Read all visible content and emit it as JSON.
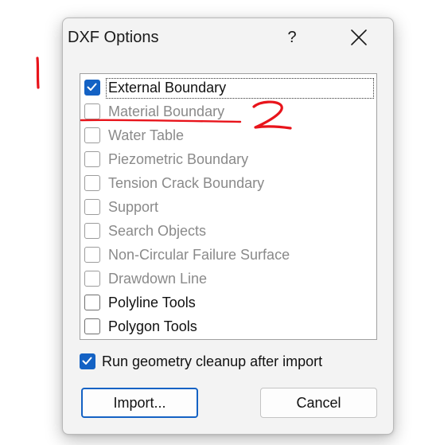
{
  "dialog": {
    "title": "DXF Options",
    "help_label": "?",
    "close_icon": "close-icon"
  },
  "list": {
    "items": [
      {
        "label": "External Boundary",
        "checked": true,
        "enabled": true
      },
      {
        "label": "Material Boundary",
        "checked": false,
        "enabled": false
      },
      {
        "label": "Water Table",
        "checked": false,
        "enabled": false
      },
      {
        "label": "Piezometric Boundary",
        "checked": false,
        "enabled": false
      },
      {
        "label": "Tension Crack Boundary",
        "checked": false,
        "enabled": false
      },
      {
        "label": "Support",
        "checked": false,
        "enabled": false
      },
      {
        "label": "Search Objects",
        "checked": false,
        "enabled": false
      },
      {
        "label": "Non-Circular Failure Surface",
        "checked": false,
        "enabled": false
      },
      {
        "label": "Drawdown Line",
        "checked": false,
        "enabled": false
      },
      {
        "label": "Polyline Tools",
        "checked": false,
        "enabled": true
      },
      {
        "label": "Polygon Tools",
        "checked": false,
        "enabled": true
      }
    ]
  },
  "cleanup": {
    "label": "Run geometry cleanup after import",
    "checked": true
  },
  "buttons": {
    "import_label": "Import...",
    "cancel_label": "Cancel"
  },
  "annotations": {
    "mark_1": "1",
    "mark_2": "2",
    "color": "#e8141b"
  },
  "colors": {
    "accent": "#1462c4",
    "disabled_text": "#8a8a8a"
  }
}
